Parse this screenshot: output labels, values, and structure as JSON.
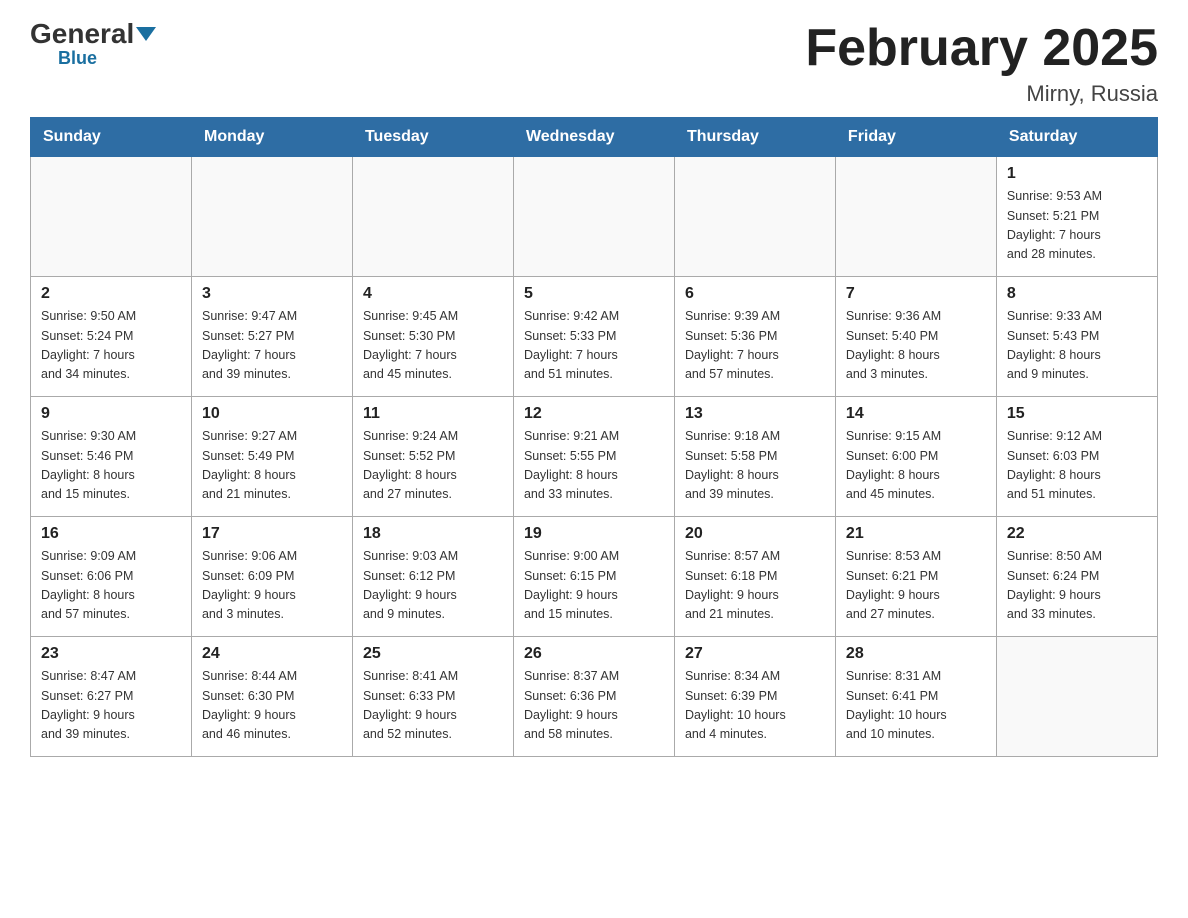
{
  "header": {
    "logo_general": "General",
    "logo_blue": "Blue",
    "title": "February 2025",
    "subtitle": "Mirny, Russia"
  },
  "weekdays": [
    "Sunday",
    "Monday",
    "Tuesday",
    "Wednesday",
    "Thursday",
    "Friday",
    "Saturday"
  ],
  "weeks": [
    [
      {
        "day": "",
        "info": ""
      },
      {
        "day": "",
        "info": ""
      },
      {
        "day": "",
        "info": ""
      },
      {
        "day": "",
        "info": ""
      },
      {
        "day": "",
        "info": ""
      },
      {
        "day": "",
        "info": ""
      },
      {
        "day": "1",
        "info": "Sunrise: 9:53 AM\nSunset: 5:21 PM\nDaylight: 7 hours\nand 28 minutes."
      }
    ],
    [
      {
        "day": "2",
        "info": "Sunrise: 9:50 AM\nSunset: 5:24 PM\nDaylight: 7 hours\nand 34 minutes."
      },
      {
        "day": "3",
        "info": "Sunrise: 9:47 AM\nSunset: 5:27 PM\nDaylight: 7 hours\nand 39 minutes."
      },
      {
        "day": "4",
        "info": "Sunrise: 9:45 AM\nSunset: 5:30 PM\nDaylight: 7 hours\nand 45 minutes."
      },
      {
        "day": "5",
        "info": "Sunrise: 9:42 AM\nSunset: 5:33 PM\nDaylight: 7 hours\nand 51 minutes."
      },
      {
        "day": "6",
        "info": "Sunrise: 9:39 AM\nSunset: 5:36 PM\nDaylight: 7 hours\nand 57 minutes."
      },
      {
        "day": "7",
        "info": "Sunrise: 9:36 AM\nSunset: 5:40 PM\nDaylight: 8 hours\nand 3 minutes."
      },
      {
        "day": "8",
        "info": "Sunrise: 9:33 AM\nSunset: 5:43 PM\nDaylight: 8 hours\nand 9 minutes."
      }
    ],
    [
      {
        "day": "9",
        "info": "Sunrise: 9:30 AM\nSunset: 5:46 PM\nDaylight: 8 hours\nand 15 minutes."
      },
      {
        "day": "10",
        "info": "Sunrise: 9:27 AM\nSunset: 5:49 PM\nDaylight: 8 hours\nand 21 minutes."
      },
      {
        "day": "11",
        "info": "Sunrise: 9:24 AM\nSunset: 5:52 PM\nDaylight: 8 hours\nand 27 minutes."
      },
      {
        "day": "12",
        "info": "Sunrise: 9:21 AM\nSunset: 5:55 PM\nDaylight: 8 hours\nand 33 minutes."
      },
      {
        "day": "13",
        "info": "Sunrise: 9:18 AM\nSunset: 5:58 PM\nDaylight: 8 hours\nand 39 minutes."
      },
      {
        "day": "14",
        "info": "Sunrise: 9:15 AM\nSunset: 6:00 PM\nDaylight: 8 hours\nand 45 minutes."
      },
      {
        "day": "15",
        "info": "Sunrise: 9:12 AM\nSunset: 6:03 PM\nDaylight: 8 hours\nand 51 minutes."
      }
    ],
    [
      {
        "day": "16",
        "info": "Sunrise: 9:09 AM\nSunset: 6:06 PM\nDaylight: 8 hours\nand 57 minutes."
      },
      {
        "day": "17",
        "info": "Sunrise: 9:06 AM\nSunset: 6:09 PM\nDaylight: 9 hours\nand 3 minutes."
      },
      {
        "day": "18",
        "info": "Sunrise: 9:03 AM\nSunset: 6:12 PM\nDaylight: 9 hours\nand 9 minutes."
      },
      {
        "day": "19",
        "info": "Sunrise: 9:00 AM\nSunset: 6:15 PM\nDaylight: 9 hours\nand 15 minutes."
      },
      {
        "day": "20",
        "info": "Sunrise: 8:57 AM\nSunset: 6:18 PM\nDaylight: 9 hours\nand 21 minutes."
      },
      {
        "day": "21",
        "info": "Sunrise: 8:53 AM\nSunset: 6:21 PM\nDaylight: 9 hours\nand 27 minutes."
      },
      {
        "day": "22",
        "info": "Sunrise: 8:50 AM\nSunset: 6:24 PM\nDaylight: 9 hours\nand 33 minutes."
      }
    ],
    [
      {
        "day": "23",
        "info": "Sunrise: 8:47 AM\nSunset: 6:27 PM\nDaylight: 9 hours\nand 39 minutes."
      },
      {
        "day": "24",
        "info": "Sunrise: 8:44 AM\nSunset: 6:30 PM\nDaylight: 9 hours\nand 46 minutes."
      },
      {
        "day": "25",
        "info": "Sunrise: 8:41 AM\nSunset: 6:33 PM\nDaylight: 9 hours\nand 52 minutes."
      },
      {
        "day": "26",
        "info": "Sunrise: 8:37 AM\nSunset: 6:36 PM\nDaylight: 9 hours\nand 58 minutes."
      },
      {
        "day": "27",
        "info": "Sunrise: 8:34 AM\nSunset: 6:39 PM\nDaylight: 10 hours\nand 4 minutes."
      },
      {
        "day": "28",
        "info": "Sunrise: 8:31 AM\nSunset: 6:41 PM\nDaylight: 10 hours\nand 10 minutes."
      },
      {
        "day": "",
        "info": ""
      }
    ]
  ]
}
